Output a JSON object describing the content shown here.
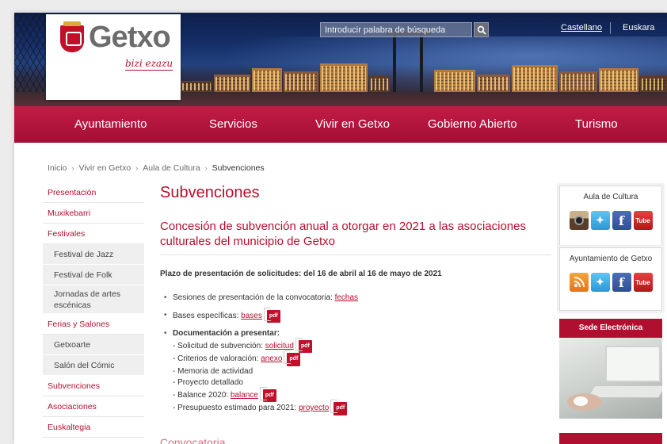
{
  "header": {
    "logo_text": "Getxo",
    "logo_tagline": "bizi ezazu",
    "search_placeholder": "Introducir palabra de búsqueda",
    "languages": [
      "Castellano",
      "Euskara"
    ]
  },
  "nav": [
    "Ayuntamiento",
    "Servicios",
    "Vivir en Getxo",
    "Gobierno Abierto",
    "Turismo"
  ],
  "breadcrumb": [
    "Inicio",
    "Vivir en Getxo",
    "Aula de Cultura",
    "Subvenciones"
  ],
  "sidebar": {
    "items": [
      {
        "label": "Presentación",
        "type": "main"
      },
      {
        "label": "Muxikebarri",
        "type": "main"
      },
      {
        "label": "Festivales",
        "type": "main"
      },
      {
        "label": "Festival de Jazz",
        "type": "sub"
      },
      {
        "label": "Festival de Folk",
        "type": "sub"
      },
      {
        "label": "Jornadas de artes escénicas",
        "type": "sub"
      },
      {
        "label": "Ferias y Salones",
        "type": "main"
      },
      {
        "label": "Getxoarte",
        "type": "sub"
      },
      {
        "label": "Salón del Cómic",
        "type": "sub"
      },
      {
        "label": "Subvenciones",
        "type": "main"
      },
      {
        "label": "Asociaciones",
        "type": "main"
      },
      {
        "label": "Euskaltegia",
        "type": "main"
      }
    ]
  },
  "main": {
    "title": "Subvenciones",
    "subtitle": "Concesión de subvención anual a otorgar en 2021 a las asociaciones culturales del municipio de Getxo",
    "deadline": "Plazo de presentación de solicitudes: del 16 de abril al 16 de mayo de 2021",
    "sessions": {
      "text": "Sesiones de presentación de la convocatoria:",
      "link": "fechas"
    },
    "bases": {
      "text": "Bases específicas:",
      "link": "bases"
    },
    "docs": {
      "heading": "Documentación a presentar:",
      "items": [
        {
          "text": "- Solicitud de subvención:",
          "link": "solicitud"
        },
        {
          "text": "- Criterios de valoración:",
          "link": "anexo"
        },
        {
          "text": "- Memoria de actividad",
          "link": ""
        },
        {
          "text": "- Proyecto detallado",
          "link": ""
        },
        {
          "text": "- Balance 2020:",
          "link": "balance"
        },
        {
          "text": "- Presupuesto estimado para 2021:",
          "link": "proyecto"
        }
      ]
    },
    "pdf_label": "pdf",
    "next_heading": "Convocatoria"
  },
  "right": {
    "box1_title": "Aula de Cultura",
    "box2_title": "Ayuntamiento de Getxo",
    "sede_title": "Sede Electrónica",
    "icons1": [
      "instagram-icon",
      "twitter-icon",
      "facebook-icon",
      "youtube-icon"
    ],
    "icons2": [
      "rss-icon",
      "twitter-icon",
      "facebook-icon",
      "youtube-icon"
    ],
    "youtube_label": "Tube",
    "facebook_label": "f"
  },
  "colors": {
    "brand_red": "#b4102e",
    "nav_red": "#c21c46",
    "text": "#333333"
  }
}
